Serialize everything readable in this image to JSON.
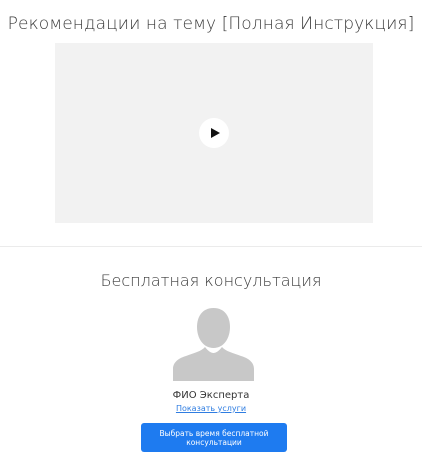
{
  "video_section": {
    "title": "Рекомендации на тему [Полная Инструкция]"
  },
  "consultation": {
    "title": "Бесплатная консультация",
    "expert_name": "ФИО Эксперта",
    "services_link": "Показать услуги",
    "book_button": "Выбрать время бесплатной консультации"
  },
  "icons": {
    "play": "play-icon",
    "avatar": "user-silhouette-icon"
  },
  "colors": {
    "accent": "#1e7bf0",
    "link": "#2f7de1",
    "video_background": "#f2f2f2",
    "avatar": "#c8c8c8"
  }
}
